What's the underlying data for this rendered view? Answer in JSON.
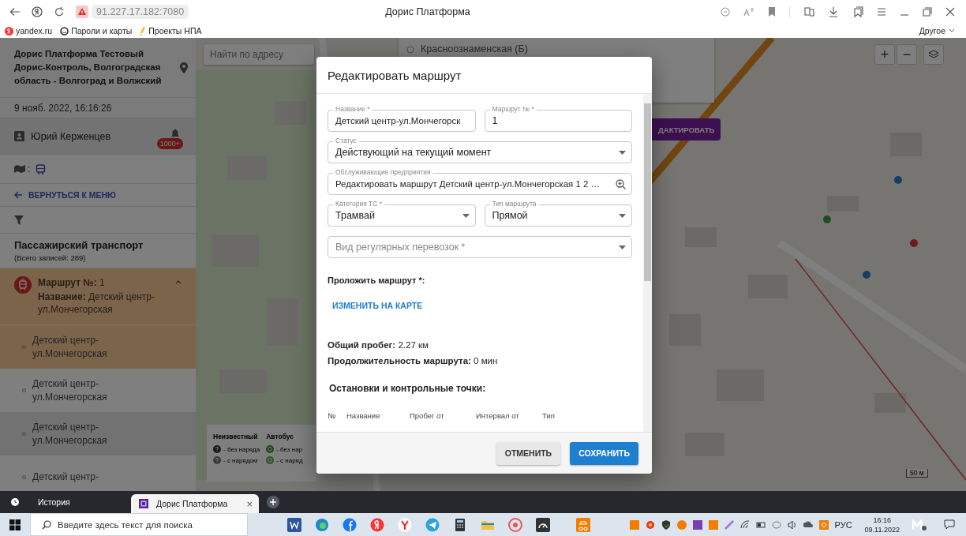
{
  "browser": {
    "url": "91.227.17.182:7080",
    "title": "Дорис Платформа",
    "bookmarks": [
      {
        "kind": "yandex",
        "label": "yandex.ru"
      },
      {
        "kind": "passwords",
        "label": "Пароли и карты"
      },
      {
        "kind": "pencil",
        "label": "Проекты НПА"
      }
    ],
    "other": "Другое"
  },
  "sidebar": {
    "org": "Дорис Платформа Тестовый Дорис-Контроль, Волгоградская область - Волгоград и Волжский",
    "datetime": "9 нояб. 2022, 16:16:26",
    "user": "Юрий Керженцев",
    "badge": "1000+",
    "transport_separator": ":",
    "back": "ВЕРНУТЬСЯ К МЕНЮ",
    "section": "Пассажирский транспорт",
    "count": "(Всего записей: 289)",
    "route": {
      "number": "**Маршрут №:** 1",
      "name": "**Название:** Детский центр-ул.Мончегорская",
      "expanded": true
    },
    "stops": [
      {
        "name": "Детский центр-ул.Мончегорская",
        "selected": true
      },
      {
        "name": "Детский центр-ул.Мончегорская",
        "selected": false
      },
      {
        "name": "Детский центр-ул.Мончегорская",
        "selected": false
      },
      {
        "name": "Детский центр-",
        "selected": false
      }
    ]
  },
  "map": {
    "search_placeholder": "Найти по адресу",
    "stop_option": "Красноознаменская (Б)",
    "edit_button": "ДАКТИРОВАТЬ",
    "zoom_in": "+",
    "zoom_out": "−",
    "scale": "50 м",
    "legend": [
      {
        "title": "Неизвестный",
        "kind": "unknown",
        "rows": [
          "- без наряда",
          "- с нарядом"
        ]
      },
      {
        "title": "Автобус",
        "kind": "bus",
        "rows": [
          "- без нар",
          "- с наряд"
        ]
      }
    ]
  },
  "dialog": {
    "title": "Редактировать маршрут",
    "form": [
      {
        "fields": [
          {
            "kind": "text",
            "label": "Название *",
            "value": "Детский центр-ул.Мончегорск"
          },
          {
            "kind": "text",
            "label": "Маршрут № *",
            "value": "1"
          }
        ]
      },
      {
        "fields": [
          {
            "kind": "select",
            "label": "Статус",
            "value": "Действующий на текущий момент"
          }
        ]
      },
      {
        "fields": [
          {
            "kind": "search",
            "label": "Обслуживающие предприятия",
            "value": "Редактировать маршрут Детский центр-ул.Мончегорская  1  2  …"
          }
        ]
      },
      {
        "fields": [
          {
            "kind": "select",
            "label": "Категория ТС *",
            "value": "Трамвай"
          },
          {
            "kind": "select",
            "label": "Тип маршрута",
            "value": "Прямой"
          }
        ]
      },
      {
        "fields": [
          {
            "kind": "select",
            "placeholder": "Вид регулярных перевозок *"
          }
        ]
      }
    ],
    "route_heading": "Проложить маршрут *:",
    "map_link": "ИЗМЕНИТЬ НА КАРТЕ",
    "stats": [
      "**Общий пробег:** 2.27 км",
      "**Продолжительность маршрута:** 0 мин"
    ],
    "stops_heading": "Остановки и контрольные точки:",
    "columns": [
      "№",
      "Название",
      "Пробег от",
      "Интервал от",
      "Тип"
    ],
    "buttons": [
      {
        "kind": "secondary",
        "label": "ОТМЕНИТЬ"
      },
      {
        "kind": "primary",
        "label": "СОХРАНИТЬ"
      }
    ]
  },
  "tabs": {
    "history": "История",
    "items": [
      {
        "label": "Дорис Платформа",
        "selected": true
      }
    ],
    "close": "×"
  },
  "taskbar": {
    "search_placeholder": "Введите здесь текст для поиска",
    "language": "РУС",
    "time": "16:16",
    "date": "09.11.2022"
  }
}
